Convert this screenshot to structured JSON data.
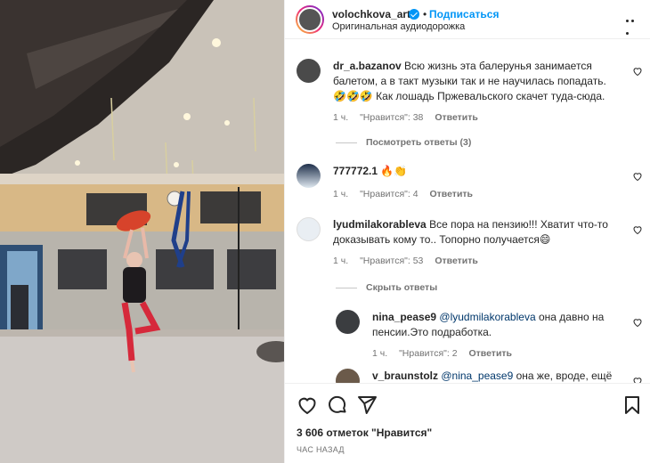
{
  "post": {
    "username": "volochkova_art",
    "follow_label": "Подписаться",
    "separator": "•",
    "audio_label": "Оригинальная аудиодорожка"
  },
  "comments": [
    {
      "user": "dr_a.bazanov",
      "text": "Всю жизнь эта балерунья занимается балетом, а в такт музыки так и не научилась попадать. 🤣🤣🤣 Как лошадь Пржевальского скачет туда-сюда.",
      "time": "1 ч.",
      "likes": "\"Нравится\": 38",
      "reply": "Ответить",
      "thread": "Посмотреть ответы (3)"
    },
    {
      "user": "777772.1",
      "text": "🔥👏",
      "time": "1 ч.",
      "likes": "\"Нравится\": 4",
      "reply": "Ответить"
    },
    {
      "user": "lyudmilakorableva",
      "text": "Все пора на пензию!!! Хватит что-то доказывать кому то.. Топорно получается😄",
      "time": "1 ч.",
      "likes": "\"Нравится\": 53",
      "reply": "Ответить",
      "thread": "Скрыть ответы"
    }
  ],
  "replies": [
    {
      "user": "nina_pease9",
      "mention": "@lyudmilakorableva",
      "text": "она давно на пенсии.Это подработка.",
      "time": "1 ч.",
      "likes": "\"Нравится\": 2",
      "reply": "Ответить"
    },
    {
      "user": "v_braunstolz",
      "mention": "@nina_pease9",
      "text": "она же, вроде, ещё"
    }
  ],
  "footer": {
    "likes_count": "3 606 отметок \"Нравится\"",
    "time_ago": "ЧАС НАЗАД"
  },
  "icons": [
    "heart-icon",
    "comment-icon",
    "share-icon",
    "bookmark-icon",
    "more-icon",
    "verified-icon"
  ],
  "colors": {
    "accent": "#0095f6",
    "text": "#262626",
    "muted": "#737373",
    "mention": "#00376b"
  }
}
